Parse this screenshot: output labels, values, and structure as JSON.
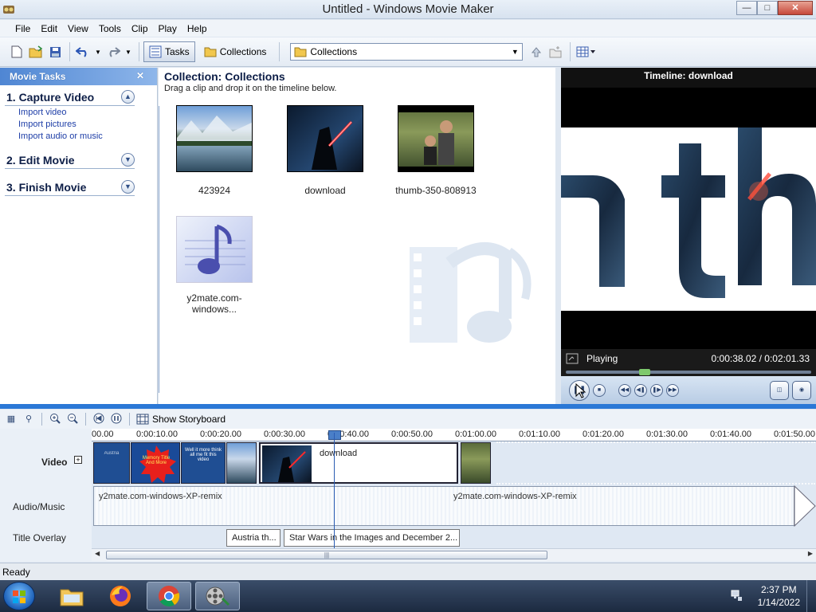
{
  "window": {
    "title": "Untitled - Windows Movie Maker",
    "minimize_label": "—",
    "maximize_label": "□",
    "close_label": "✕"
  },
  "menu": [
    "File",
    "Edit",
    "View",
    "Tools",
    "Clip",
    "Play",
    "Help"
  ],
  "toolbar": {
    "tasks_label": "Tasks",
    "collections_label": "Collections",
    "collection_selected": "Collections"
  },
  "tasks_pane": {
    "header": "Movie Tasks",
    "close": "✕",
    "sections": [
      {
        "title": "1. Capture Video",
        "expanded": true,
        "links": [
          "Import video",
          "Import pictures",
          "Import audio or music"
        ]
      },
      {
        "title": "2. Edit Movie",
        "expanded": false,
        "links": []
      },
      {
        "title": "3. Finish Movie",
        "expanded": false,
        "links": []
      }
    ]
  },
  "collection": {
    "title": "Collection: Collections",
    "subtitle": "Drag a clip and drop it on the timeline below.",
    "clips": [
      "423924",
      "download",
      "thumb-350-808913",
      "y2mate.com-windows..."
    ]
  },
  "preview": {
    "title": "Timeline: download",
    "status": "Playing",
    "time": "0:00:38.02 / 0:02:01.33",
    "seek_fraction": 0.313
  },
  "timeline_toolbar": {
    "show_storyboard": "Show Storyboard"
  },
  "timeline": {
    "ruler": [
      "00.00",
      "0:00:10.00",
      "0:00:20.00",
      "0:00:30.00",
      "0:00:40.00",
      "0:00:50.00",
      "0:01:00.00",
      "0:01:10.00",
      "0:01:20.00",
      "0:01:30.00",
      "0:01:40.00",
      "0:01:50.00"
    ],
    "tracks": {
      "video": "Video",
      "audio": "Audio/Music",
      "title": "Title Overlay"
    },
    "video_clip_label": "download",
    "video_clip_texts": [
      "Austria",
      "Memory Title And More",
      "Well it more think all me fit this video"
    ],
    "audio_label": "y2mate.com-windows-XP-remix",
    "title_clips": [
      "Austria th...",
      "Star Wars in the Images and December 2..."
    ],
    "playhead_time": "0:00:38.02"
  },
  "status": "Ready",
  "clock": {
    "time": "2:37 PM",
    "date": "1/14/2022"
  },
  "colors": {
    "accent": "#2b78d6",
    "task_header": "#4f86d3",
    "link": "#1e3ea7"
  }
}
